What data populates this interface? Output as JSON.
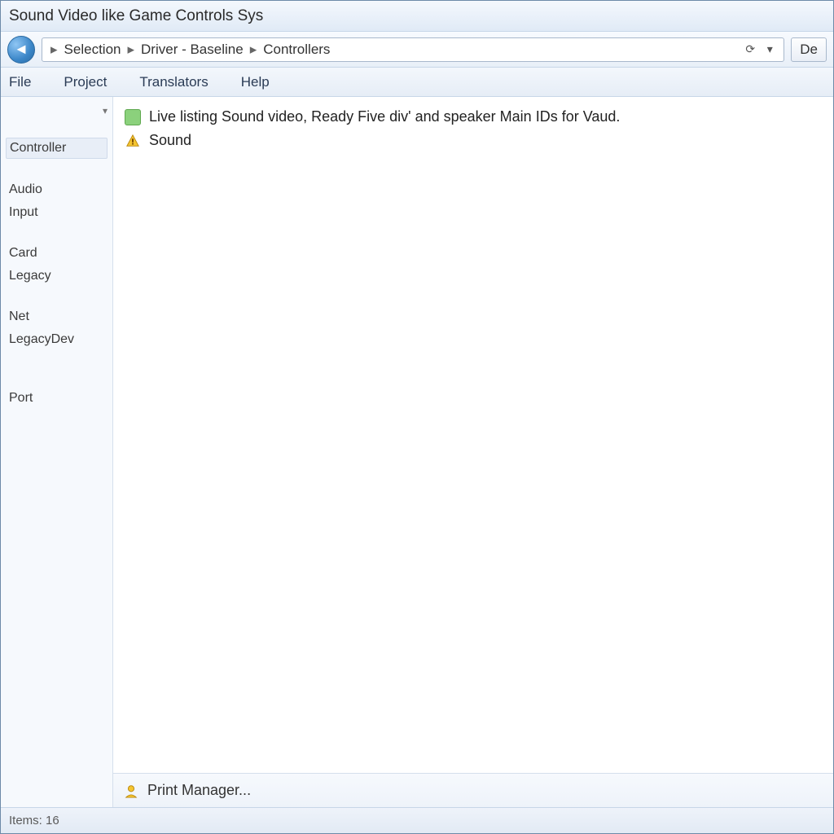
{
  "title": "Sound Video like Game Controls Sys",
  "breadcrumb": {
    "seg1": "Selection",
    "seg2": "Driver - Baseline",
    "seg3": "Controllers"
  },
  "search_button": "De",
  "menu": {
    "m1": "File",
    "m2": "Project",
    "m3": "Translators",
    "m4": "Help"
  },
  "sidebar": {
    "header": "",
    "items": [
      "",
      "Controller",
      "",
      "Audio",
      "Input",
      "",
      "Card",
      "Legacy",
      "",
      "Net",
      "LegacyDev",
      "",
      "",
      "Port"
    ]
  },
  "sidebar_selected_index": 1,
  "list": {
    "row1": "Live listing Sound video, Ready Five div' and speaker Main IDs for Vaud.",
    "row2": "Sound"
  },
  "statusbar": {
    "label": "Print Manager..."
  },
  "outer_status": "Items: 16",
  "icons": {
    "back": "back-arrow-icon",
    "sep": "chevron-right-icon",
    "refresh": "refresh-icon",
    "dropdown": "chevron-down-icon",
    "device": "device-ok-icon",
    "warn": "warning-icon",
    "user": "user-icon"
  }
}
